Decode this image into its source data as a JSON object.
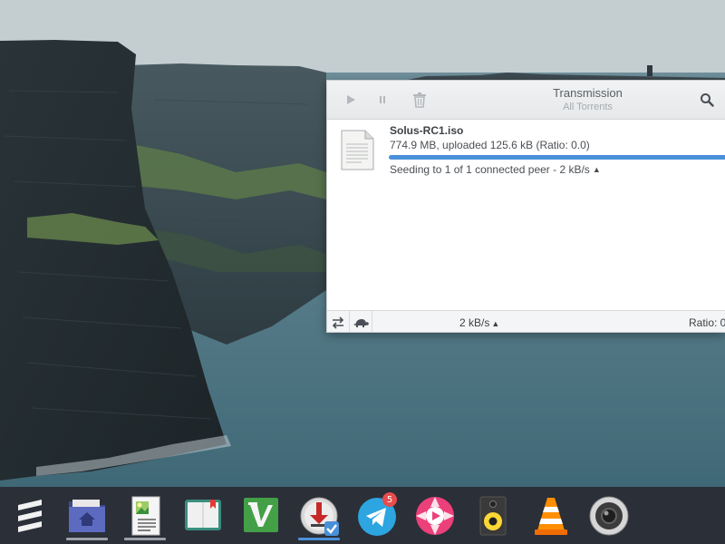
{
  "window": {
    "title": "Transmission",
    "subtitle": "All Torrents",
    "toolbar": {
      "start_icon": "play-icon",
      "pause_icon": "pause-icon",
      "remove_icon": "trash-icon",
      "search_icon": "search-icon"
    },
    "torrents": [
      {
        "name": "Solus-RC1.iso",
        "info": "774.9 MB, uploaded 125.6 kB (Ratio: 0.0)",
        "progress": 1.0,
        "status": "Seeding to 1 of 1 connected peer - 2 kB/s",
        "status_arrow": "▲"
      }
    ],
    "statusbar": {
      "speed": "2 kB/s",
      "speed_arrow": "▲",
      "ratio": "Ratio: 0",
      "transfer_icon": "transfer-arrows-icon",
      "turtle_icon": "turtle-icon"
    }
  },
  "dock": {
    "items": [
      {
        "name": "budgie-menu",
        "icon": "menu-lines-icon",
        "running": false
      },
      {
        "name": "files",
        "icon": "folder-home-icon",
        "running": true
      },
      {
        "name": "image-viewer",
        "icon": "image-document-icon",
        "running": true
      },
      {
        "name": "book-reader",
        "icon": "book-icon",
        "running": false
      },
      {
        "name": "vim",
        "icon": "vim-icon",
        "running": false
      },
      {
        "name": "transmission",
        "icon": "transmission-icon",
        "running": true,
        "active": true
      },
      {
        "name": "telegram",
        "icon": "telegram-icon",
        "running": false,
        "badge": "5"
      },
      {
        "name": "music-player",
        "icon": "music-player-icon",
        "running": false
      },
      {
        "name": "speaker",
        "icon": "speaker-icon",
        "running": false
      },
      {
        "name": "vlc",
        "icon": "vlc-cone-icon",
        "running": false
      },
      {
        "name": "webcam",
        "icon": "webcam-icon",
        "running": false
      }
    ]
  },
  "colors": {
    "accent": "#4a90d9",
    "dock_bg": "#2b2f38",
    "indicator": "#9aa0a8",
    "indicator_active": "#4a90d9",
    "badge": "#e74c4c"
  }
}
